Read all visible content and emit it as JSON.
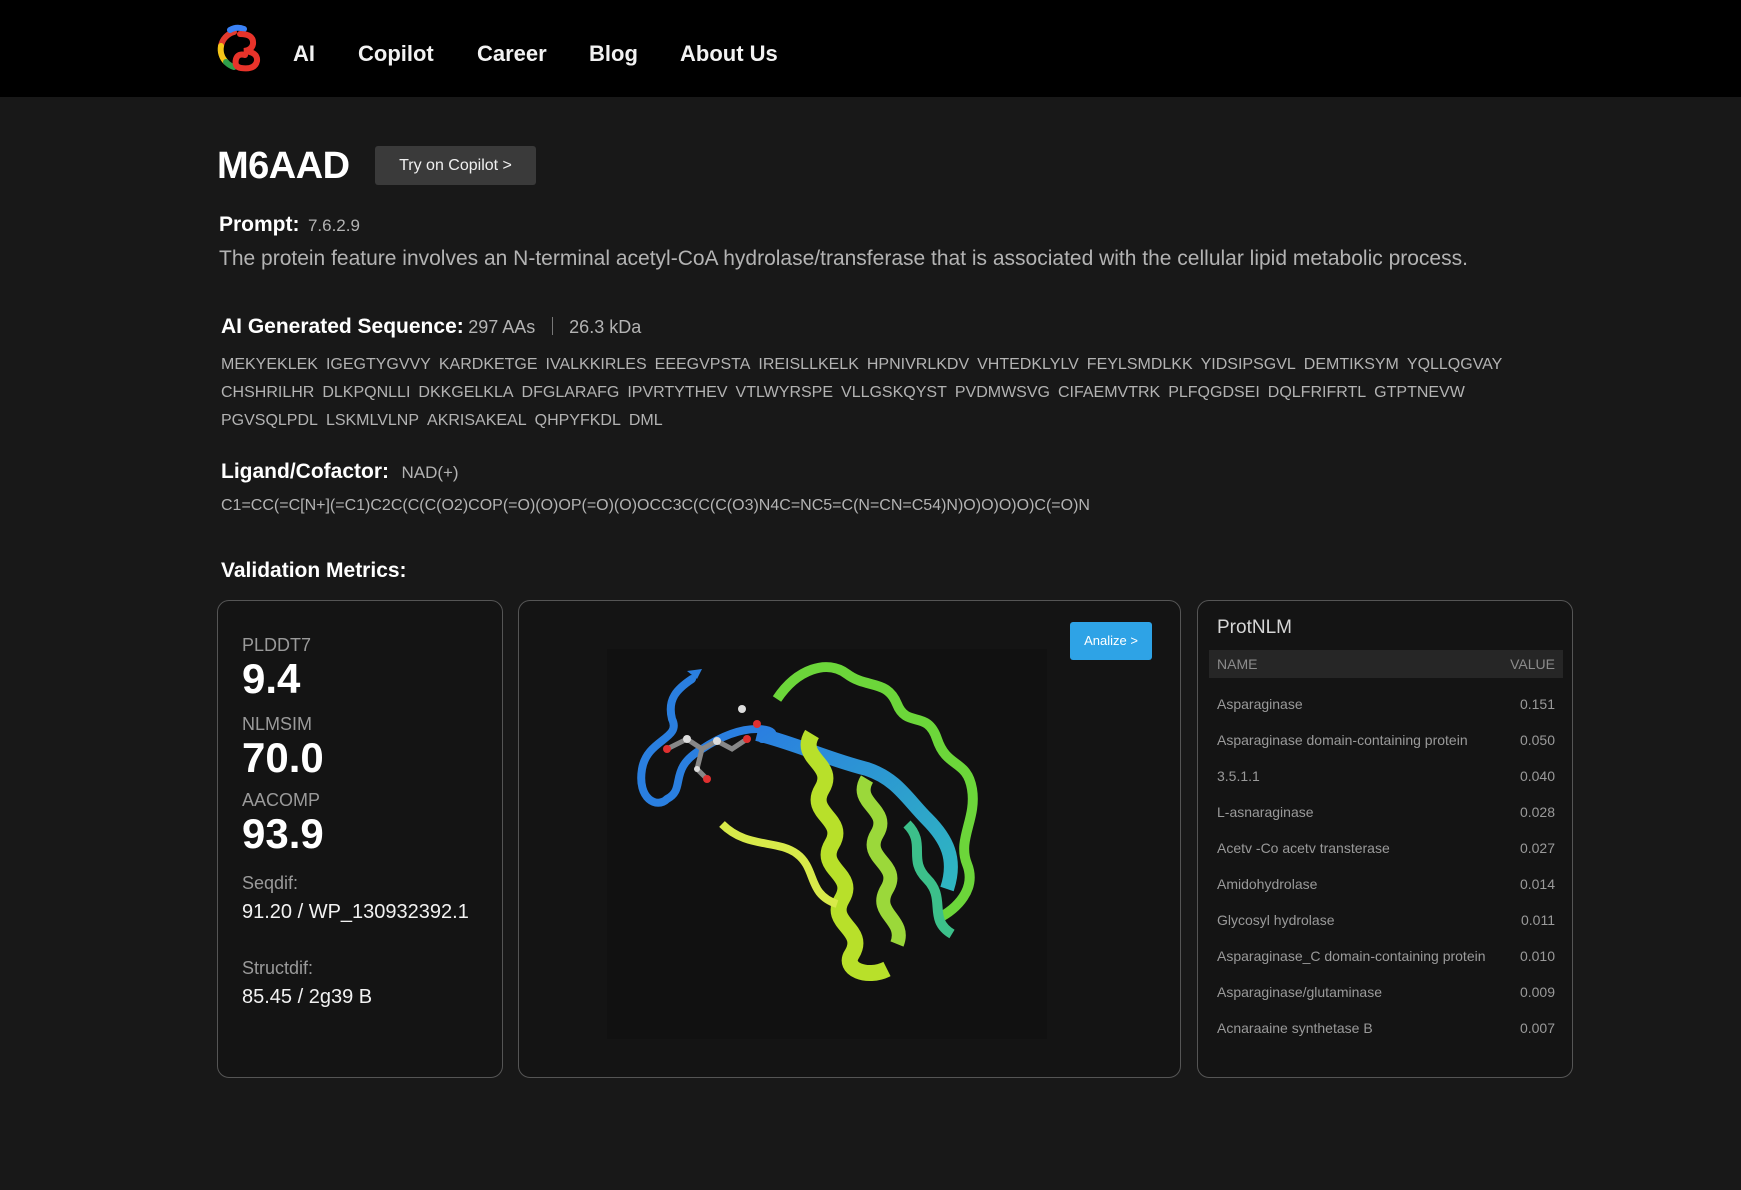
{
  "nav": {
    "items": [
      "AI",
      "Copilot",
      "Career",
      "Blog",
      "About Us"
    ]
  },
  "header": {
    "title": "M6AAD",
    "copilot_button": "Try on Copilot >"
  },
  "prompt": {
    "label": "Prompt:",
    "value": "7.6.2.9",
    "text": "The protein feature involves an N-terminal acetyl-CoA hydrolase/transferase that is associated with the cellular lipid metabolic process."
  },
  "sequence": {
    "label": "AI Generated Sequence:",
    "length": "297 AAs",
    "mass": "26.3 kDa",
    "chunks": [
      "MEKYEKLEK",
      "IGEGTYGVVY",
      "KARDKETGE",
      "IVALKKIRLES",
      "EEEGVPSTA",
      "IREISLLKELK",
      "HPNIVRLKDV",
      "VHTEDKLYLV",
      "FEYLSMDLKK",
      "YIDSIPSGVL",
      "DEMTIKSYM",
      "YQLLQGVAY",
      "CHSHRILHR",
      "DLKPQNLLI",
      "DKKGELKLA",
      "DFGLARAFG",
      "IPVRTYTHEV",
      "VTLWYRSPE",
      "VLLGSKQYST",
      "PVDMWSVG",
      "CIFAEMVTRK",
      "PLFQGDSEI",
      "DQLFRIFRTL",
      "GTPTNEVW",
      "PGVSQLPDL",
      "LSKMLVLNP",
      "AKRISAKEAL",
      "QHPYFKDL",
      "DML"
    ]
  },
  "ligand": {
    "label": "Ligand/Cofactor:",
    "value": "NAD(+)",
    "smiles": "C1=CC(=C[N+](=C1)C2C(C(C(O2)COP(=O)(O)OP(=O)(O)OCC3C(C(C(O3)N4C=NC5=C(N=CN=C54)N)O)O)O)O)C(=O)N"
  },
  "validation": {
    "title": "Validation Metrics:",
    "metrics": [
      {
        "label": "PLDDT7",
        "value": "9.4"
      },
      {
        "label": "NLMSIM",
        "value": "70.0"
      },
      {
        "label": "AACOMP",
        "value": "93.9"
      }
    ],
    "seqdif": {
      "label": "Seqdif:",
      "value": "91.20  / WP_130932392.1"
    },
    "structdif": {
      "label": "Structdif:",
      "value": "85.45 / 2g39 B"
    },
    "analize_button": "Analize >"
  },
  "protnlm": {
    "title": "ProtNLM",
    "col_name": "NAME",
    "col_value": "VALUE",
    "rows": [
      {
        "name": "Asparaginase",
        "value": "0.151"
      },
      {
        "name": "Asparaginase domain-containing protein",
        "value": "0.050"
      },
      {
        "name": "3.5.1.1",
        "value": "0.040"
      },
      {
        "name": "L-asnaraginase",
        "value": "0.028"
      },
      {
        "name": "Acetv -Co acetv transterase",
        "value": "0.027"
      },
      {
        "name": "Amidohydrolase",
        "value": "0.014"
      },
      {
        "name": "Glycosyl hydrolase",
        "value": "0.011"
      },
      {
        "name": "Asparaginase_C domain-containing protein",
        "value": "0.010"
      },
      {
        "name": "Asparaginase/glutaminase",
        "value": "0.009"
      },
      {
        "name": "Acnaraaine synthetase B",
        "value": "0.007"
      }
    ]
  }
}
